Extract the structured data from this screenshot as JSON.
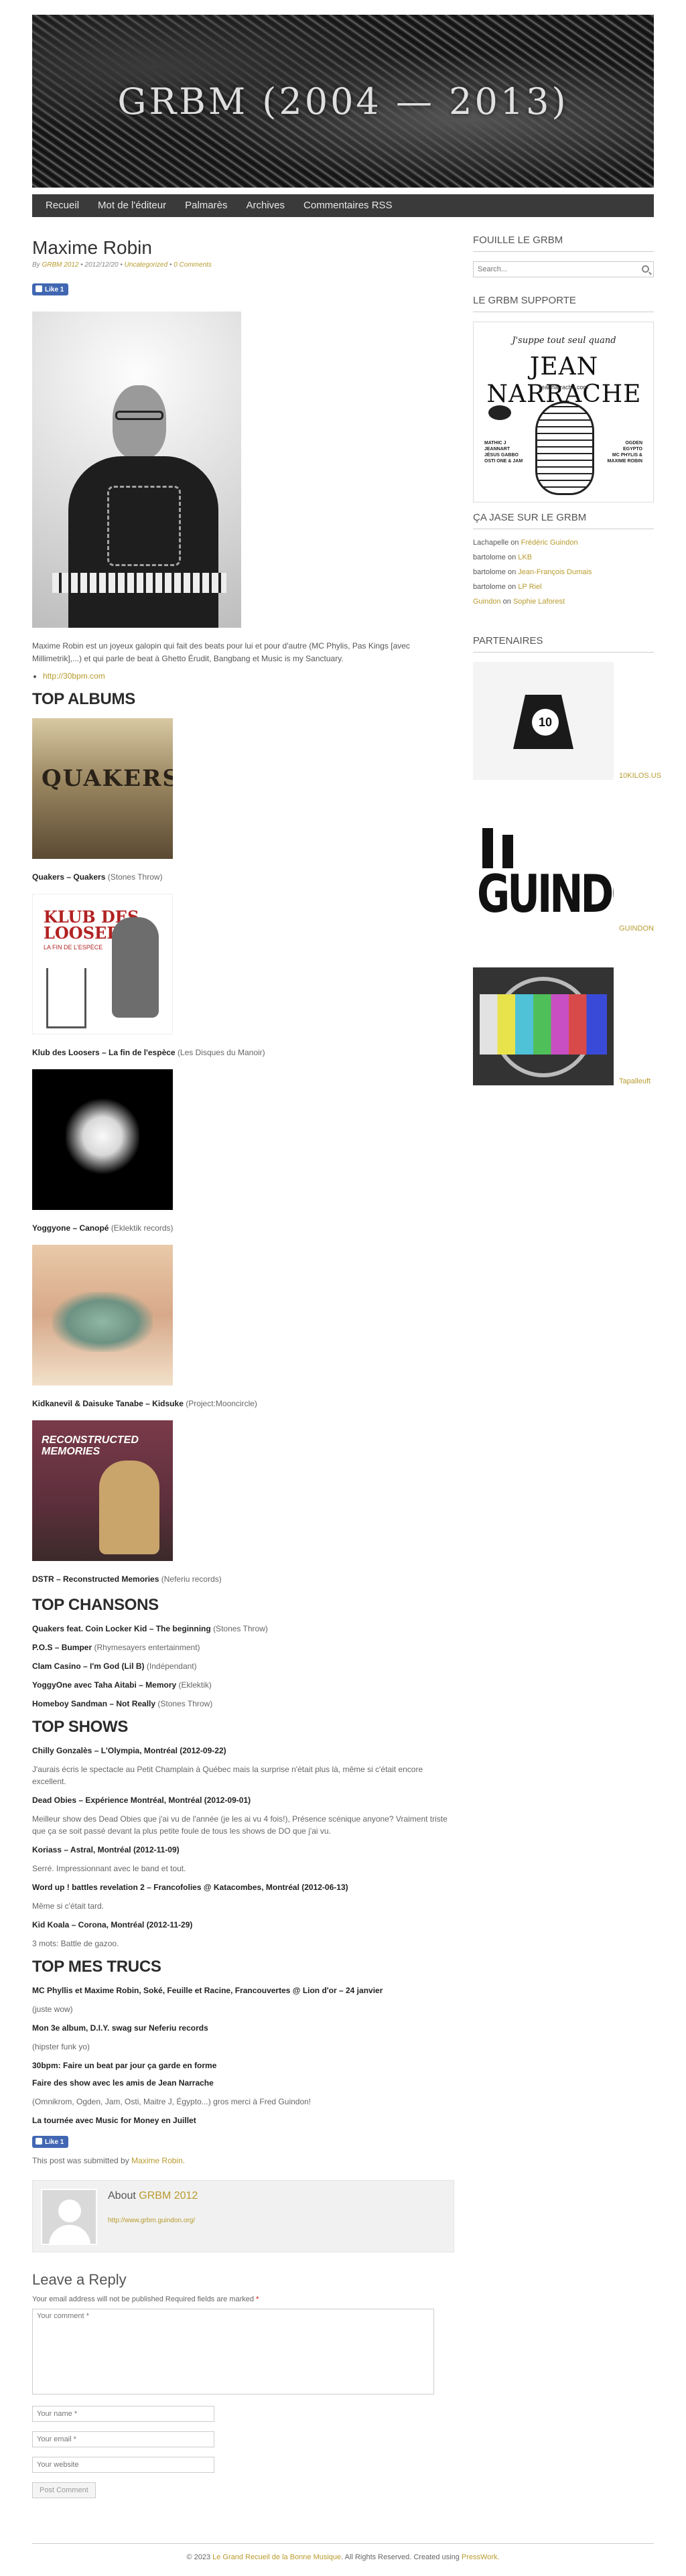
{
  "site": {
    "title": "GRBM (2004 — 2013)"
  },
  "nav": {
    "items": [
      {
        "label": "Recueil"
      },
      {
        "label": "Mot de l'éditeur"
      },
      {
        "label": "Palmarès"
      },
      {
        "label": "Archives"
      },
      {
        "label": "Commentaires RSS"
      }
    ]
  },
  "post": {
    "title": "Maxime Robin",
    "meta": {
      "by": "By",
      "author": "GRBM 2012",
      "date": "2012/12/20",
      "category": "Uncategorized",
      "comments": "0 Comments"
    },
    "like_label": "Like 1",
    "intro": "Maxime Robin est un joyeux galopin qui fait des beats pour lui et pour d'autre (MC Phylis, Pas Kings [avec Millimetrik],...) et qui parle de beat à Ghetto Érudit, Bangbang et Music is my Sanctuary.",
    "links": [
      "http://30bpm.com"
    ],
    "submitted_prefix": "This post was submitted by",
    "submitted_author": "Maxime Robin."
  },
  "sections": {
    "albums": "TOP ALBUMS",
    "songs": "TOP CHANSONS",
    "shows": "TOP SHOWS",
    "trucs": "TOP MES TRUCS"
  },
  "albums": [
    {
      "title": "Quakers – Quakers",
      "label": "(Stones Throw)",
      "cover_text": "QUAKERS"
    },
    {
      "title": "Klub des Loosers – La fin de l'espèce",
      "label": "(Les Disques du Manoir)",
      "cover_text": "KLUB DES LOOSERS",
      "cover_sub": "LA FIN DE L'ESPÈCE"
    },
    {
      "title": "Yoggyone – Canopé",
      "label": "(Eklektik records)"
    },
    {
      "title": "Kidkanevil & Daisuke Tanabe – Kidsuke",
      "label": "(Project:Mooncircle)"
    },
    {
      "title": "DSTR – Reconstructed Memories",
      "label": "(Neferiu records)",
      "cover_text": "RECONSTRUCTED MEMORIES"
    }
  ],
  "songs": [
    {
      "title": "Quakers feat. Coin Locker Kid – The beginning",
      "label": "(Stones Throw)"
    },
    {
      "title": "P.O.S – Bumper",
      "label": "(Rhymesayers entertainment)"
    },
    {
      "title": "Clam Casino – I'm God (Lil B)",
      "label": "(Indépendant)"
    },
    {
      "title": "YoggyOne avec Taha Aitabi – Memory",
      "label": "(Eklektik)"
    },
    {
      "title": "Homeboy Sandman – Not Really",
      "label": "(Stones Throw)"
    }
  ],
  "shows": [
    {
      "title": "Chilly Gonzalès – L'Olympia, Montréal (2012-09-22)",
      "desc": "J'aurais écris le spectacle au Petit Champlain à Québec mais la surprise n'était plus là, même si c'était encore excellent."
    },
    {
      "title": "Dead Obies – Expérience Montréal, Montréal (2012-09-01)",
      "desc": "Meilleur show des Dead Obies que j'ai vu de l'année (je les ai vu 4 fois!), Présence scénique anyone? Vraiment triste que ça se soit passé devant la plus petite foule de tous les shows de DO que j'ai vu."
    },
    {
      "title": "Koriass – Astral, Montréal (2012-11-09)",
      "desc": "Serré. Impressionnant avec le band et tout."
    },
    {
      "title": "Word up ! battles revelation 2 – Francofolies @ Katacombes, Montréal (2012-06-13)",
      "desc": "Même si c'était tard."
    },
    {
      "title": "Kid Koala – Corona, Montréal (2012-11-29)",
      "desc": "3 mots: Battle de gazoo."
    }
  ],
  "trucs": [
    {
      "title": "MC Phyllis et Maxime Robin, Soké, Feuille et Racine, Francouvertes @ Lion d'or – 24 janvier",
      "desc": "(juste wow)"
    },
    {
      "title": "Mon 3e album, D.I.Y. swag sur Neferiu records",
      "desc": "(hipster funk yo)"
    },
    {
      "title": "30bpm: Faire un beat par jour ça garde en forme",
      "desc": ""
    },
    {
      "title": "Faire des show avec les amis de Jean Narrache",
      "desc": "(Omnikrom, Ogden, Jam, Osti, Maitre J, Égypto...) gros merci à Fred Guindon!"
    },
    {
      "title": "La tournée avec Music for Money en Juillet",
      "desc": ""
    }
  ],
  "author_box": {
    "about_prefix": "About",
    "name": "GRBM 2012",
    "url": "http://www.grbm.guindon.org/"
  },
  "reply": {
    "title": "Leave a Reply",
    "note": "Your email address will not be published Required fields are marked",
    "req_mark": "*",
    "comment_placeholder": "Your comment *",
    "name_placeholder": "Your name *",
    "email_placeholder": "Your email *",
    "website_placeholder": "Your website",
    "submit_label": "Post Comment"
  },
  "sidebar": {
    "search_title": "FOUILLE LE GRBM",
    "search_placeholder": "Search...",
    "supporte_title": "LE GRBM SUPPORTE",
    "poster": {
      "line1": "J'suppe tout seul quand",
      "line2": "JEAN NARRACHE",
      "line3": "jeannarrache.com",
      "left": "MATHIC J\nJEANNART\nJÉSUS GABBO\nOSTI ONE & JAM",
      "right": "OGDEN\nEGYPTO\nMC PHYLIS &\nMAXIME ROBIN"
    },
    "jase_title": "ÇA JASE SUR LE GRBM",
    "jase": [
      {
        "who": "Lachapelle",
        "on": "on",
        "target": "Frédéric Guindon"
      },
      {
        "who": "bartolome",
        "on": "on",
        "target": "LKB"
      },
      {
        "who": "bartolome",
        "on": "on",
        "target": "Jean-François Dumais"
      },
      {
        "who": "bartolome",
        "on": "on",
        "target": "LP Riel"
      },
      {
        "who": "Guindon",
        "on": "on",
        "target": "Sophie Laforest"
      }
    ],
    "partners_title": "PARTENAIRES",
    "partners": [
      {
        "name": "10KILOS.US",
        "badge": "10"
      },
      {
        "name": "GUINDON",
        "logo_text": "GUINDON"
      },
      {
        "name": "Tapalleuft"
      }
    ]
  },
  "footer": {
    "copyright": "© 2023",
    "site_link": "Le Grand Recueil de la Bonne Musique",
    "rights": ". All Rights Reserved. Created using",
    "credit": "PressWork."
  }
}
